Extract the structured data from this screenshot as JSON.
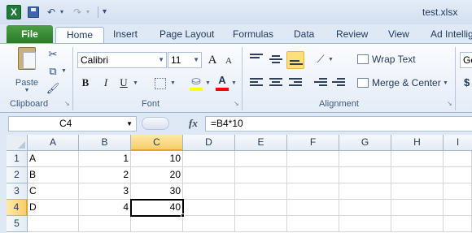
{
  "app": {
    "window_title": "test.xlsx",
    "logo_letter": "X"
  },
  "quick_access": {
    "save_icon": "save-icon",
    "undo_glyph": "↶",
    "redo_glyph": "↷",
    "dropdown_glyph": "▾",
    "customize_glyph": "▾"
  },
  "tabs": {
    "file": "File",
    "items": [
      "Home",
      "Insert",
      "Page Layout",
      "Formulas",
      "Data",
      "Review",
      "View",
      "Ad Intellig"
    ],
    "active": "Home"
  },
  "ribbon": {
    "clipboard": {
      "label": "Clipboard",
      "paste": "Paste",
      "cut_glyph": "✂",
      "copy_glyph": "⧉",
      "format_painter_glyph": "🖌"
    },
    "font": {
      "label": "Font",
      "font_name": "Calibri",
      "font_size": "11",
      "grow": "A",
      "shrink": "A",
      "bold": "B",
      "italic": "I",
      "underline": "U",
      "font_color_letter": "A",
      "fill_color": "#ffff00",
      "font_color": "#ff0000"
    },
    "alignment": {
      "label": "Alignment",
      "wrap_text": "Wrap Text",
      "merge_center": "Merge & Center"
    },
    "number": {
      "format_value": "Ge",
      "currency": "$"
    }
  },
  "formula_bar": {
    "name_box": "C4",
    "fx": "fx",
    "formula": "=B4*10"
  },
  "sheet": {
    "columns": [
      "A",
      "B",
      "C",
      "D",
      "E",
      "F",
      "G",
      "H",
      "I"
    ],
    "rows": [
      "1",
      "2",
      "3",
      "4",
      "5"
    ],
    "selected_column": "C",
    "selected_row": "4",
    "active_cell": "C4",
    "cells": {
      "A1": "A",
      "B1": "1",
      "C1": "10",
      "A2": "B",
      "B2": "2",
      "C2": "20",
      "A3": "C",
      "B3": "3",
      "C3": "30",
      "A4": "D",
      "B4": "4",
      "C4": "40"
    }
  }
}
